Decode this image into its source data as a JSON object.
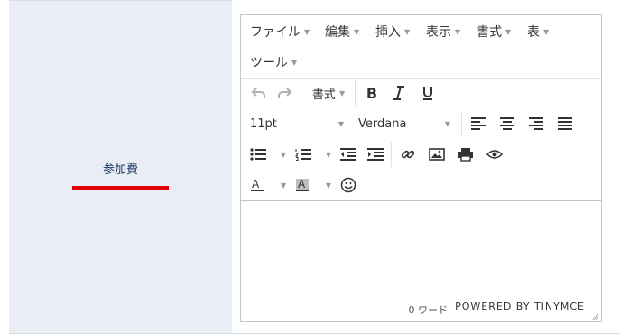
{
  "row_label": "参加費",
  "menubar": {
    "items": [
      "ファイル",
      "編集",
      "挿入",
      "表示",
      "書式",
      "表",
      "ツール"
    ]
  },
  "toolbar": {
    "format_label": "書式",
    "font_size": "11pt",
    "font_family": "Verdana",
    "icons": [
      "undo-icon",
      "redo-icon",
      "bold-icon",
      "italic-icon",
      "underline-icon",
      "align-left-icon",
      "align-center-icon",
      "align-right-icon",
      "align-justify-icon",
      "bullet-list-icon",
      "numbered-list-icon",
      "outdent-icon",
      "indent-icon",
      "link-icon",
      "image-icon",
      "print-icon",
      "preview-icon",
      "text-color-icon",
      "background-color-icon",
      "emoticon-icon"
    ]
  },
  "statusbar": {
    "wordcount": "0 ワード",
    "branding": "POWERED BY TINYMCE"
  },
  "colors": {
    "label_background": "#e9edf4",
    "accent_red": "#e00000",
    "label_text": "#1f3864"
  }
}
